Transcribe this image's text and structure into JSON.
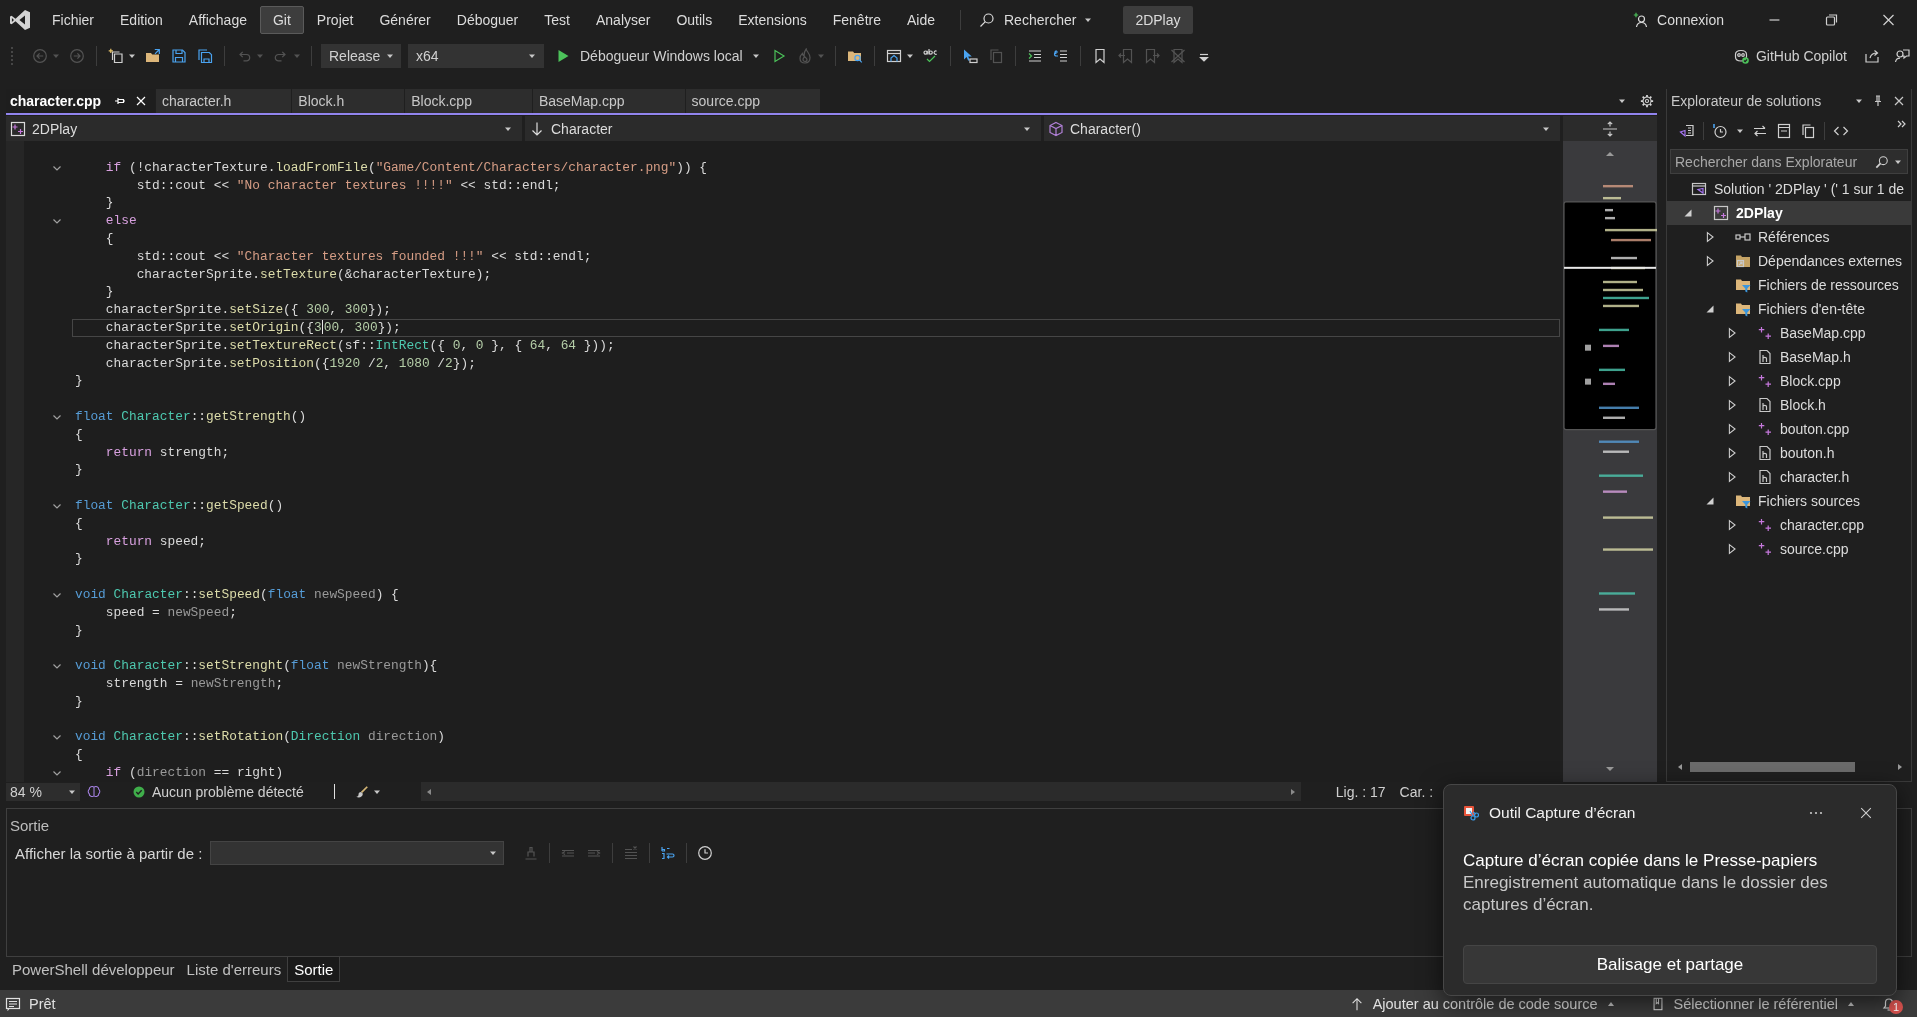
{
  "title_bar": {
    "menus": [
      {
        "label": "Fichier",
        "highlighted": false
      },
      {
        "label": "Edition",
        "highlighted": false
      },
      {
        "label": "Affichage",
        "highlighted": false
      },
      {
        "label": "Git",
        "highlighted": true
      },
      {
        "label": "Projet",
        "highlighted": false
      },
      {
        "label": "Générer",
        "highlighted": false
      },
      {
        "label": "Déboguer",
        "highlighted": false
      },
      {
        "label": "Test",
        "highlighted": false
      },
      {
        "label": "Analyser",
        "highlighted": false
      },
      {
        "label": "Outils",
        "highlighted": false
      },
      {
        "label": "Extensions",
        "highlighted": false
      },
      {
        "label": "Fenêtre",
        "highlighted": false
      },
      {
        "label": "Aide",
        "highlighted": false
      }
    ],
    "search": "Rechercher",
    "solution_name": "2DPlay",
    "sign_in": "Connexion"
  },
  "toolbar": {
    "items": [
      {
        "kind": "back",
        "disabled": true,
        "menu": true
      },
      {
        "kind": "forward",
        "disabled": true,
        "menu": false
      },
      {
        "kind": "separator"
      },
      {
        "kind": "newitem",
        "disabled": false,
        "menu": true
      },
      {
        "kind": "folder",
        "disabled": false,
        "menu": false
      },
      {
        "kind": "save",
        "disabled": false,
        "menu": false
      },
      {
        "kind": "saveall",
        "disabled": false,
        "menu": false
      },
      {
        "kind": "separator"
      },
      {
        "kind": "undo",
        "disabled": true,
        "menu": true
      },
      {
        "kind": "redo",
        "disabled": true,
        "menu": true
      },
      {
        "kind": "separator"
      },
      {
        "kind": "combo",
        "value": "Release"
      },
      {
        "kind": "combo",
        "value": "x64"
      },
      {
        "kind": "run",
        "label": "Débogueur Windows local",
        "menu": true
      },
      {
        "kind": "play",
        "disabled": false,
        "menu": false
      },
      {
        "kind": "flame",
        "disabled": true,
        "menu": true
      },
      {
        "kind": "separator"
      },
      {
        "kind": "foldersearch",
        "disabled": false,
        "menu": false
      },
      {
        "kind": "separator"
      },
      {
        "kind": "window",
        "disabled": false,
        "menu": true
      },
      {
        "kind": "spellcheck",
        "disabled": false,
        "menu": false
      },
      {
        "kind": "separator"
      },
      {
        "kind": "pointer",
        "disabled": false,
        "menu": false
      },
      {
        "kind": "copy",
        "disabled": true,
        "menu": false
      },
      {
        "kind": "separator"
      },
      {
        "kind": "indent",
        "disabled": false,
        "menu": false
      },
      {
        "kind": "outdent",
        "disabled": false,
        "menu": false
      },
      {
        "kind": "separator"
      },
      {
        "kind": "bookmark",
        "disabled": false,
        "menu": false
      },
      {
        "kind": "bookmarkprev",
        "disabled": true,
        "menu": false
      },
      {
        "kind": "bookmarknext",
        "disabled": true,
        "menu": false
      },
      {
        "kind": "bookmarkclear",
        "disabled": true,
        "menu": false
      },
      {
        "kind": "overflow",
        "disabled": false,
        "menu": false
      }
    ],
    "copilot": "GitHub Copilot"
  },
  "editor": {
    "tabs": [
      {
        "label": "character.cpp",
        "selected": true
      },
      {
        "label": "character.h",
        "selected": false
      },
      {
        "label": "Block.h",
        "selected": false
      },
      {
        "label": "Block.cpp",
        "selected": false
      },
      {
        "label": "BaseMap.cpp",
        "selected": false
      },
      {
        "label": "source.cpp",
        "selected": false
      }
    ],
    "nav": {
      "project": "2DPlay",
      "scope": "Character",
      "member": "Character()"
    },
    "lines": [
      {
        "fold": false,
        "current": false
      },
      {
        "fold": true,
        "current": false,
        "tokens": [
          {
            "kind": "control",
            "text": "    if"
          },
          {
            "kind": "plain",
            "text": " (!characterTexture."
          },
          {
            "kind": "function",
            "text": "loadFromFile"
          },
          {
            "kind": "plain",
            "text": "("
          },
          {
            "kind": "string",
            "text": "\"Game/Content/Characters/character.png\""
          },
          {
            "kind": "plain",
            "text": ")) {"
          }
        ]
      },
      {
        "fold": false,
        "current": false,
        "tokens": [
          {
            "kind": "plain",
            "text": "        std::cout << "
          },
          {
            "kind": "string",
            "text": "\"No character textures !!!!\""
          },
          {
            "kind": "plain",
            "text": " << std::endl;"
          }
        ]
      },
      {
        "fold": false,
        "current": false,
        "tokens": [
          {
            "kind": "plain",
            "text": "    }"
          }
        ]
      },
      {
        "fold": true,
        "current": false,
        "tokens": [
          {
            "kind": "control",
            "text": "    else"
          }
        ]
      },
      {
        "fold": false,
        "current": false,
        "tokens": [
          {
            "kind": "plain",
            "text": "    {"
          }
        ]
      },
      {
        "fold": false,
        "current": false,
        "tokens": [
          {
            "kind": "plain",
            "text": "        std::cout << "
          },
          {
            "kind": "string",
            "text": "\"Character textures founded !!!\""
          },
          {
            "kind": "plain",
            "text": " << std::endl;"
          }
        ]
      },
      {
        "fold": false,
        "current": false,
        "tokens": [
          {
            "kind": "plain",
            "text": "        characterSprite."
          },
          {
            "kind": "function",
            "text": "setTexture"
          },
          {
            "kind": "plain",
            "text": "(&characterTexture);"
          }
        ]
      },
      {
        "fold": false,
        "current": false,
        "tokens": [
          {
            "kind": "plain",
            "text": "    }"
          }
        ]
      },
      {
        "fold": false,
        "current": false,
        "tokens": [
          {
            "kind": "plain",
            "text": "    characterSprite."
          },
          {
            "kind": "function",
            "text": "setSize"
          },
          {
            "kind": "plain",
            "text": "({ "
          },
          {
            "kind": "number",
            "text": "300"
          },
          {
            "kind": "plain",
            "text": ", "
          },
          {
            "kind": "number",
            "text": "300"
          },
          {
            "kind": "plain",
            "text": "});"
          }
        ]
      },
      {
        "fold": false,
        "current": true,
        "tokens": [
          {
            "kind": "plain",
            "text": "    characterSprite."
          },
          {
            "kind": "function",
            "text": "setOrigin"
          },
          {
            "kind": "plain",
            "text": "({"
          },
          {
            "kind": "number",
            "text": "3"
          },
          {
            "kind": "caret"
          },
          {
            "kind": "number",
            "text": "00"
          },
          {
            "kind": "plain",
            "text": ", "
          },
          {
            "kind": "number",
            "text": "300"
          },
          {
            "kind": "plain",
            "text": "});"
          }
        ]
      },
      {
        "fold": false,
        "current": false,
        "tokens": [
          {
            "kind": "plain",
            "text": "    characterSprite."
          },
          {
            "kind": "function",
            "text": "setTextureRect"
          },
          {
            "kind": "plain",
            "text": "(sf::"
          },
          {
            "kind": "type",
            "text": "IntRect"
          },
          {
            "kind": "plain",
            "text": "({ "
          },
          {
            "kind": "number",
            "text": "0"
          },
          {
            "kind": "plain",
            "text": ", "
          },
          {
            "kind": "number",
            "text": "0"
          },
          {
            "kind": "plain",
            "text": " }, { "
          },
          {
            "kind": "number",
            "text": "64"
          },
          {
            "kind": "plain",
            "text": ", "
          },
          {
            "kind": "number",
            "text": "64"
          },
          {
            "kind": "plain",
            "text": " }));"
          }
        ]
      },
      {
        "fold": false,
        "current": false,
        "tokens": [
          {
            "kind": "plain",
            "text": "    characterSprite."
          },
          {
            "kind": "function",
            "text": "setPosition"
          },
          {
            "kind": "plain",
            "text": "({"
          },
          {
            "kind": "number",
            "text": "1920"
          },
          {
            "kind": "plain",
            "text": " /"
          },
          {
            "kind": "number",
            "text": "2"
          },
          {
            "kind": "plain",
            "text": ", "
          },
          {
            "kind": "number",
            "text": "1080"
          },
          {
            "kind": "plain",
            "text": " /"
          },
          {
            "kind": "number",
            "text": "2"
          },
          {
            "kind": "plain",
            "text": "});"
          }
        ]
      },
      {
        "fold": false,
        "current": false,
        "tokens": [
          {
            "kind": "plain",
            "text": "}"
          }
        ]
      },
      {
        "fold": false,
        "current": false
      },
      {
        "fold": true,
        "current": false,
        "tokens": [
          {
            "kind": "keyword",
            "text": "float "
          },
          {
            "kind": "type",
            "text": "Character"
          },
          {
            "kind": "plain",
            "text": "::"
          },
          {
            "kind": "function",
            "text": "getStrength"
          },
          {
            "kind": "plain",
            "text": "()"
          }
        ]
      },
      {
        "fold": false,
        "current": false,
        "tokens": [
          {
            "kind": "plain",
            "text": "{"
          }
        ]
      },
      {
        "fold": false,
        "current": false,
        "tokens": [
          {
            "kind": "control",
            "text": "    return"
          },
          {
            "kind": "plain",
            "text": " strength;"
          }
        ]
      },
      {
        "fold": false,
        "current": false,
        "tokens": [
          {
            "kind": "plain",
            "text": "}"
          }
        ]
      },
      {
        "fold": false,
        "current": false
      },
      {
        "fold": true,
        "current": false,
        "tokens": [
          {
            "kind": "keyword",
            "text": "float "
          },
          {
            "kind": "type",
            "text": "Character"
          },
          {
            "kind": "plain",
            "text": "::"
          },
          {
            "kind": "function",
            "text": "getSpeed"
          },
          {
            "kind": "plain",
            "text": "()"
          }
        ]
      },
      {
        "fold": false,
        "current": false,
        "tokens": [
          {
            "kind": "plain",
            "text": "{"
          }
        ]
      },
      {
        "fold": false,
        "current": false,
        "tokens": [
          {
            "kind": "control",
            "text": "    return"
          },
          {
            "kind": "plain",
            "text": " speed;"
          }
        ]
      },
      {
        "fold": false,
        "current": false,
        "tokens": [
          {
            "kind": "plain",
            "text": "}"
          }
        ]
      },
      {
        "fold": false,
        "current": false
      },
      {
        "fold": true,
        "current": false,
        "tokens": [
          {
            "kind": "keyword",
            "text": "void "
          },
          {
            "kind": "type",
            "text": "Character"
          },
          {
            "kind": "plain",
            "text": "::"
          },
          {
            "kind": "function",
            "text": "setSpeed"
          },
          {
            "kind": "plain",
            "text": "("
          },
          {
            "kind": "keyword",
            "text": "float "
          },
          {
            "kind": "parameter",
            "text": "newSpeed"
          },
          {
            "kind": "plain",
            "text": ") {"
          }
        ]
      },
      {
        "fold": false,
        "current": false,
        "tokens": [
          {
            "kind": "plain",
            "text": "    speed = "
          },
          {
            "kind": "parameter",
            "text": "newSpeed"
          },
          {
            "kind": "plain",
            "text": ";"
          }
        ]
      },
      {
        "fold": false,
        "current": false,
        "tokens": [
          {
            "kind": "plain",
            "text": "}"
          }
        ]
      },
      {
        "fold": false,
        "current": false
      },
      {
        "fold": true,
        "current": false,
        "tokens": [
          {
            "kind": "keyword",
            "text": "void "
          },
          {
            "kind": "type",
            "text": "Character"
          },
          {
            "kind": "plain",
            "text": "::"
          },
          {
            "kind": "function",
            "text": "setStrenght"
          },
          {
            "kind": "plain",
            "text": "("
          },
          {
            "kind": "keyword",
            "text": "float "
          },
          {
            "kind": "parameter",
            "text": "newStrength"
          },
          {
            "kind": "plain",
            "text": "){"
          }
        ]
      },
      {
        "fold": false,
        "current": false,
        "tokens": [
          {
            "kind": "plain",
            "text": "    strength = "
          },
          {
            "kind": "parameter",
            "text": "newStrength"
          },
          {
            "kind": "plain",
            "text": ";"
          }
        ]
      },
      {
        "fold": false,
        "current": false,
        "tokens": [
          {
            "kind": "plain",
            "text": "}"
          }
        ]
      },
      {
        "fold": false,
        "current": false
      },
      {
        "fold": true,
        "current": false,
        "tokens": [
          {
            "kind": "keyword",
            "text": "void "
          },
          {
            "kind": "type",
            "text": "Character"
          },
          {
            "kind": "plain",
            "text": "::"
          },
          {
            "kind": "function",
            "text": "setRotation"
          },
          {
            "kind": "plain",
            "text": "("
          },
          {
            "kind": "type",
            "text": "Direction "
          },
          {
            "kind": "parameter",
            "text": "direction"
          },
          {
            "kind": "plain",
            "text": ")"
          }
        ]
      },
      {
        "fold": false,
        "current": false,
        "tokens": [
          {
            "kind": "plain",
            "text": "{"
          }
        ]
      },
      {
        "fold": true,
        "current": false,
        "tokens": [
          {
            "kind": "control",
            "text": "    if"
          },
          {
            "kind": "plain",
            "text": " ("
          },
          {
            "kind": "parameter",
            "text": "direction"
          },
          {
            "kind": "plain",
            "text": " == right)"
          }
        ]
      }
    ],
    "status": {
      "zoom": "84 %",
      "issues": "Aucun problème détecté",
      "line": "Lig. : 17",
      "column": "Car. :"
    }
  },
  "explorer": {
    "title": "Explorateur de solutions",
    "search": {
      "placeholder": "Rechercher dans Explorateur"
    },
    "tree": [
      {
        "label": "Solution ' 2DPlay ' (' 1 sur 1 de",
        "kind": "solution",
        "expandable": false,
        "selected": false,
        "children": [
          {
            "label": "2DPlay",
            "kind": "project",
            "expandable": true,
            "expanded": true,
            "selected": true,
            "children": [
              {
                "label": "Références",
                "kind": "references",
                "expandable": true,
                "expanded": false,
                "selected": false
              },
              {
                "label": "Dépendances externes",
                "kind": "externaldeps",
                "expandable": true,
                "expanded": false,
                "selected": false
              },
              {
                "label": "Fichiers de ressources",
                "kind": "filter",
                "expandable": false,
                "selected": false
              },
              {
                "label": "Fichiers d'en-tête",
                "kind": "filter",
                "expandable": true,
                "expanded": true,
                "selected": false,
                "children": [
                  {
                    "label": "BaseMap.cpp",
                    "kind": "cpp",
                    "expandable": true,
                    "expanded": false,
                    "selected": false
                  },
                  {
                    "label": "BaseMap.h",
                    "kind": "header",
                    "expandable": true,
                    "expanded": false,
                    "selected": false
                  },
                  {
                    "label": "Block.cpp",
                    "kind": "cpp",
                    "expandable": true,
                    "expanded": false,
                    "selected": false
                  },
                  {
                    "label": "Block.h",
                    "kind": "header",
                    "expandable": true,
                    "expanded": false,
                    "selected": false
                  },
                  {
                    "label": "bouton.cpp",
                    "kind": "cpp",
                    "expandable": true,
                    "expanded": false,
                    "selected": false
                  },
                  {
                    "label": "bouton.h",
                    "kind": "header",
                    "expandable": true,
                    "expanded": false,
                    "selected": false
                  },
                  {
                    "label": "character.h",
                    "kind": "header",
                    "expandable": true,
                    "expanded": false,
                    "selected": false
                  }
                ]
              },
              {
                "label": "Fichiers sources",
                "kind": "filter",
                "expandable": true,
                "expanded": true,
                "selected": false,
                "children": [
                  {
                    "label": "character.cpp",
                    "kind": "cpp",
                    "expandable": true,
                    "expanded": false,
                    "selected": false
                  },
                  {
                    "label": "source.cpp",
                    "kind": "cpp",
                    "expandable": true,
                    "expanded": false,
                    "selected": false
                  }
                ]
              }
            ]
          }
        ]
      }
    ]
  },
  "output": {
    "title": "Sortie",
    "source_label": "Afficher la sortie à partir de :",
    "tools": [
      {
        "kind": "clearall",
        "disabled": true
      },
      {
        "kind": "separator"
      },
      {
        "kind": "prev",
        "disabled": true
      },
      {
        "kind": "next",
        "disabled": true
      },
      {
        "kind": "separator"
      },
      {
        "kind": "clearlist",
        "disabled": true
      },
      {
        "kind": "separator"
      },
      {
        "kind": "wrap",
        "disabled": false
      },
      {
        "kind": "separator"
      },
      {
        "kind": "clock",
        "disabled": false
      }
    ]
  },
  "panel_tabs": [
    {
      "label": "PowerShell développeur",
      "selected": false
    },
    {
      "label": "Liste d'erreurs",
      "selected": false
    },
    {
      "label": "Sortie",
      "selected": true
    }
  ],
  "status_bar": {
    "state": "Prêt",
    "source_control": "Ajouter au contrôle de code source",
    "repository": "Sélectionner le référentiel",
    "notifications": "1"
  },
  "toast": {
    "app": "Outil Capture d’écran",
    "heading": "Capture d’écran copiée dans le Presse-papiers",
    "body": "Enregistrement automatique dans le dossier des captures d’écran.",
    "button": "Balisage et partage"
  }
}
